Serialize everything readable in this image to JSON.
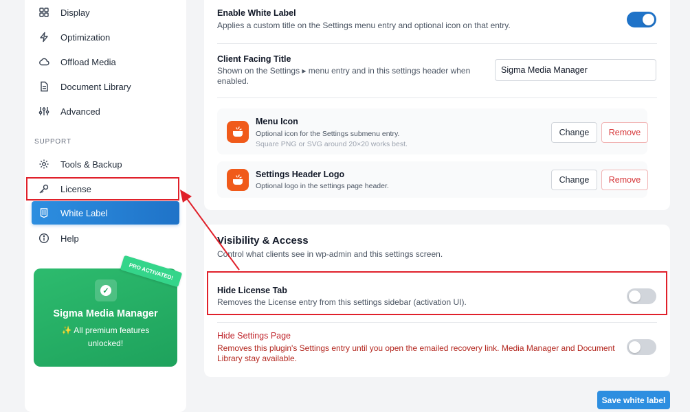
{
  "sidebar": {
    "items": [
      {
        "label": "Display",
        "icon": "grid-icon"
      },
      {
        "label": "Optimization",
        "icon": "lightning-icon"
      },
      {
        "label": "Offload Media",
        "icon": "cloud-icon"
      },
      {
        "label": "Document Library",
        "icon": "document-icon"
      },
      {
        "label": "Advanced",
        "icon": "sliders-icon"
      }
    ],
    "support_label": "SUPPORT",
    "support_items": [
      {
        "label": "Tools & Backup",
        "icon": "gear-icon"
      },
      {
        "label": "License",
        "icon": "key-icon"
      },
      {
        "label": "White Label",
        "icon": "tag-icon",
        "active": true
      },
      {
        "label": "Help",
        "icon": "info-icon"
      }
    ],
    "pro_card": {
      "badge": "PRO ACTIVATED!",
      "name": "Sigma Media Manager",
      "desc": "✨ All premium features unlocked!"
    }
  },
  "branding": {
    "enable_title": "Enable White Label",
    "enable_desc": "Applies a custom title on the Settings menu entry and optional icon on that entry.",
    "enable_state": true,
    "client_title_label": "Client Facing Title",
    "client_title_desc": "Shown on the Settings ▸ menu entry and in this settings header when enabled.",
    "client_title_value": "Sigma Media Manager",
    "menu_icon": {
      "title": "Menu Icon",
      "desc": "Optional icon for the Settings submenu entry.",
      "hint": "Square PNG or SVG around 20×20 works best.",
      "change": "Change",
      "remove": "Remove"
    },
    "header_logo": {
      "title": "Settings Header Logo",
      "desc": "Optional logo in the settings page header.",
      "change": "Change",
      "remove": "Remove"
    }
  },
  "visibility": {
    "title": "Visibility & Access",
    "desc": "Control what clients see in wp-admin and this settings screen.",
    "hide_license_title": "Hide License Tab",
    "hide_license_desc": "Removes the License entry from this settings sidebar (activation UI).",
    "hide_license_state": false,
    "hide_settings_title": "Hide Settings Page",
    "hide_settings_desc": "Removes this plugin's Settings entry until you open the emailed recovery link. Media Manager and Document Library stay available.",
    "hide_settings_state": false
  },
  "save_label": "Save white label",
  "colors": {
    "accent": "#1f73c8",
    "danger": "#d63638",
    "pro_green": "#2dbb6e",
    "annotation_red": "#e0202a"
  }
}
